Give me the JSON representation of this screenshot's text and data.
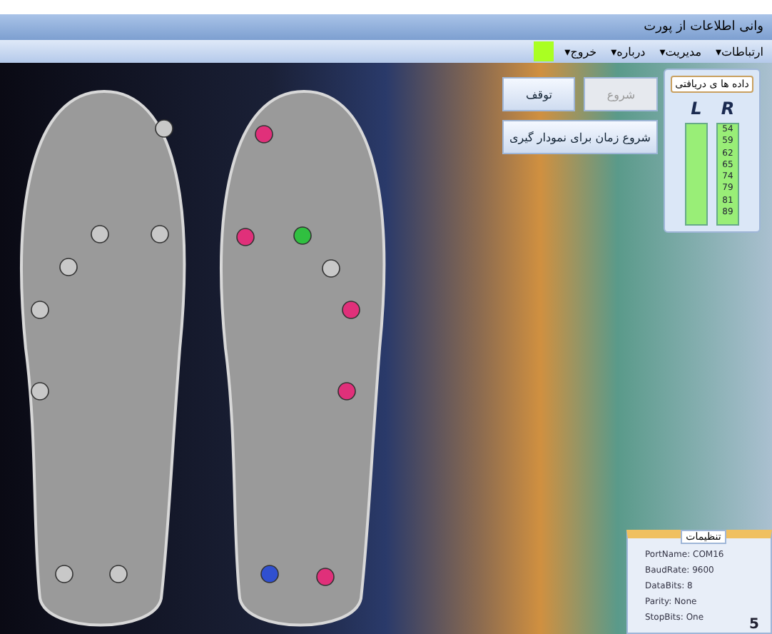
{
  "window": {
    "title": "وانی اطلاعات از پورت"
  },
  "menu": [
    {
      "label": "ارتباطات▾"
    },
    {
      "label": "مدیریت▾"
    },
    {
      "label": "درباره▾"
    },
    {
      "label": "خروج▾"
    }
  ],
  "status_indicator": {
    "color": "#aaff22"
  },
  "controls": [
    {
      "label": "شروع",
      "disabled": true
    },
    {
      "label": "توقف",
      "disabled": false
    },
    {
      "label": "شروع زمان برای نمودار گیری",
      "disabled": false
    }
  ],
  "received_data": {
    "title": "داده ها ی دریافتی",
    "left_heading": "L",
    "right_heading": "R",
    "right_values": [
      "54",
      "59",
      "62",
      "65",
      "74",
      "79",
      "81",
      "89"
    ]
  },
  "sensors": [
    {
      "color": "#c8c8c8"
    },
    {
      "color": "#c8c8c8"
    },
    {
      "color": "#c8c8c8"
    },
    {
      "color": "#c8c8c8"
    },
    {
      "color": "#c8c8c8"
    },
    {
      "color": "#c8c8c8"
    },
    {
      "color": "#c8c8c8"
    },
    {
      "color": "#c8c8c8"
    },
    {
      "color": "#e0307a"
    },
    {
      "color": "#e0307a"
    },
    {
      "color": "#30c040"
    },
    {
      "color": "#c8c8c8"
    },
    {
      "color": "#e0307a"
    },
    {
      "color": "#e0307a"
    },
    {
      "color": "#3050d0"
    },
    {
      "color": "#e0307a"
    }
  ],
  "settings": {
    "title": "تنظیمات",
    "lines": [
      "PortName: COM16",
      "BaudRate: 9600",
      "DataBits: 8",
      "Parity: None",
      "StopBits: One"
    ],
    "corner": "5"
  }
}
